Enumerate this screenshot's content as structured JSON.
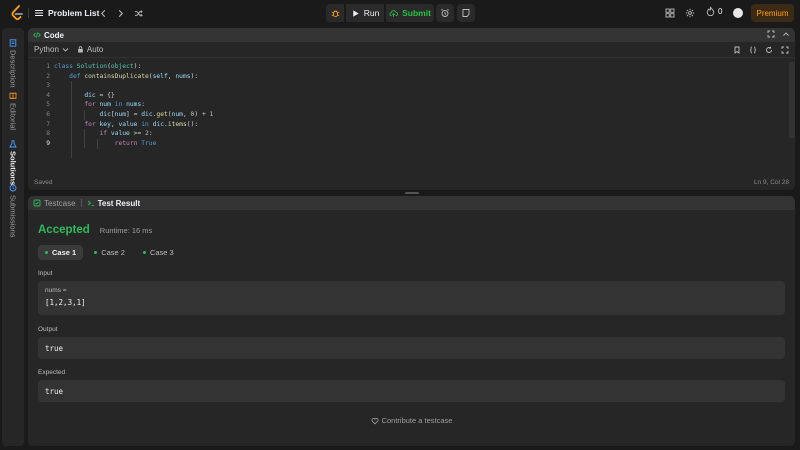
{
  "topbar": {
    "problem_list_label": "Problem List",
    "run_label": "Run",
    "submit_label": "Submit",
    "streak_count": "0",
    "premium_label": "Premium"
  },
  "rail": {
    "items": [
      {
        "label": "Description",
        "icon": "document-icon",
        "active": false
      },
      {
        "label": "Editorial",
        "icon": "book-icon",
        "active": false
      },
      {
        "label": "Solutions",
        "icon": "flask-icon",
        "active": true
      },
      {
        "label": "Submissions",
        "icon": "history-icon",
        "active": false
      }
    ]
  },
  "code_panel": {
    "title": "Code",
    "language": "Python",
    "autocomplete_label": "Auto",
    "line_numbers": [
      "1",
      "2",
      "3",
      "4",
      "5",
      "6",
      "7",
      "8",
      "9"
    ],
    "lines": [
      "class Solution(object):",
      "    def containsDuplicate(self, nums):",
      "",
      "        dic = {}",
      "        for num in nums:",
      "            dic[num] = dic.get(num, 0) + 1",
      "        for key, value in dic.items():",
      "            if value >= 2:",
      "                return True"
    ],
    "status_left": "Saved",
    "status_right": "Ln 9, Col 28"
  },
  "result_panel": {
    "tab_testcase": "Testcase",
    "tab_result": "Test Result",
    "verdict": "Accepted",
    "runtime": "Runtime: 16 ms",
    "cases": [
      "Case 1",
      "Case 2",
      "Case 3"
    ],
    "input_label": "Input",
    "input_param": "nums =",
    "input_value": "[1,2,3,1]",
    "output_label": "Output",
    "output_value": "true",
    "expected_label": "Expected",
    "expected_value": "true",
    "contribute_label": "Contribute a testcase"
  },
  "colors": {
    "accent_green": "#2cbb5d",
    "premium_orange": "#ffa116",
    "panel_bg": "#262626",
    "page_bg": "#1a1a1a"
  }
}
